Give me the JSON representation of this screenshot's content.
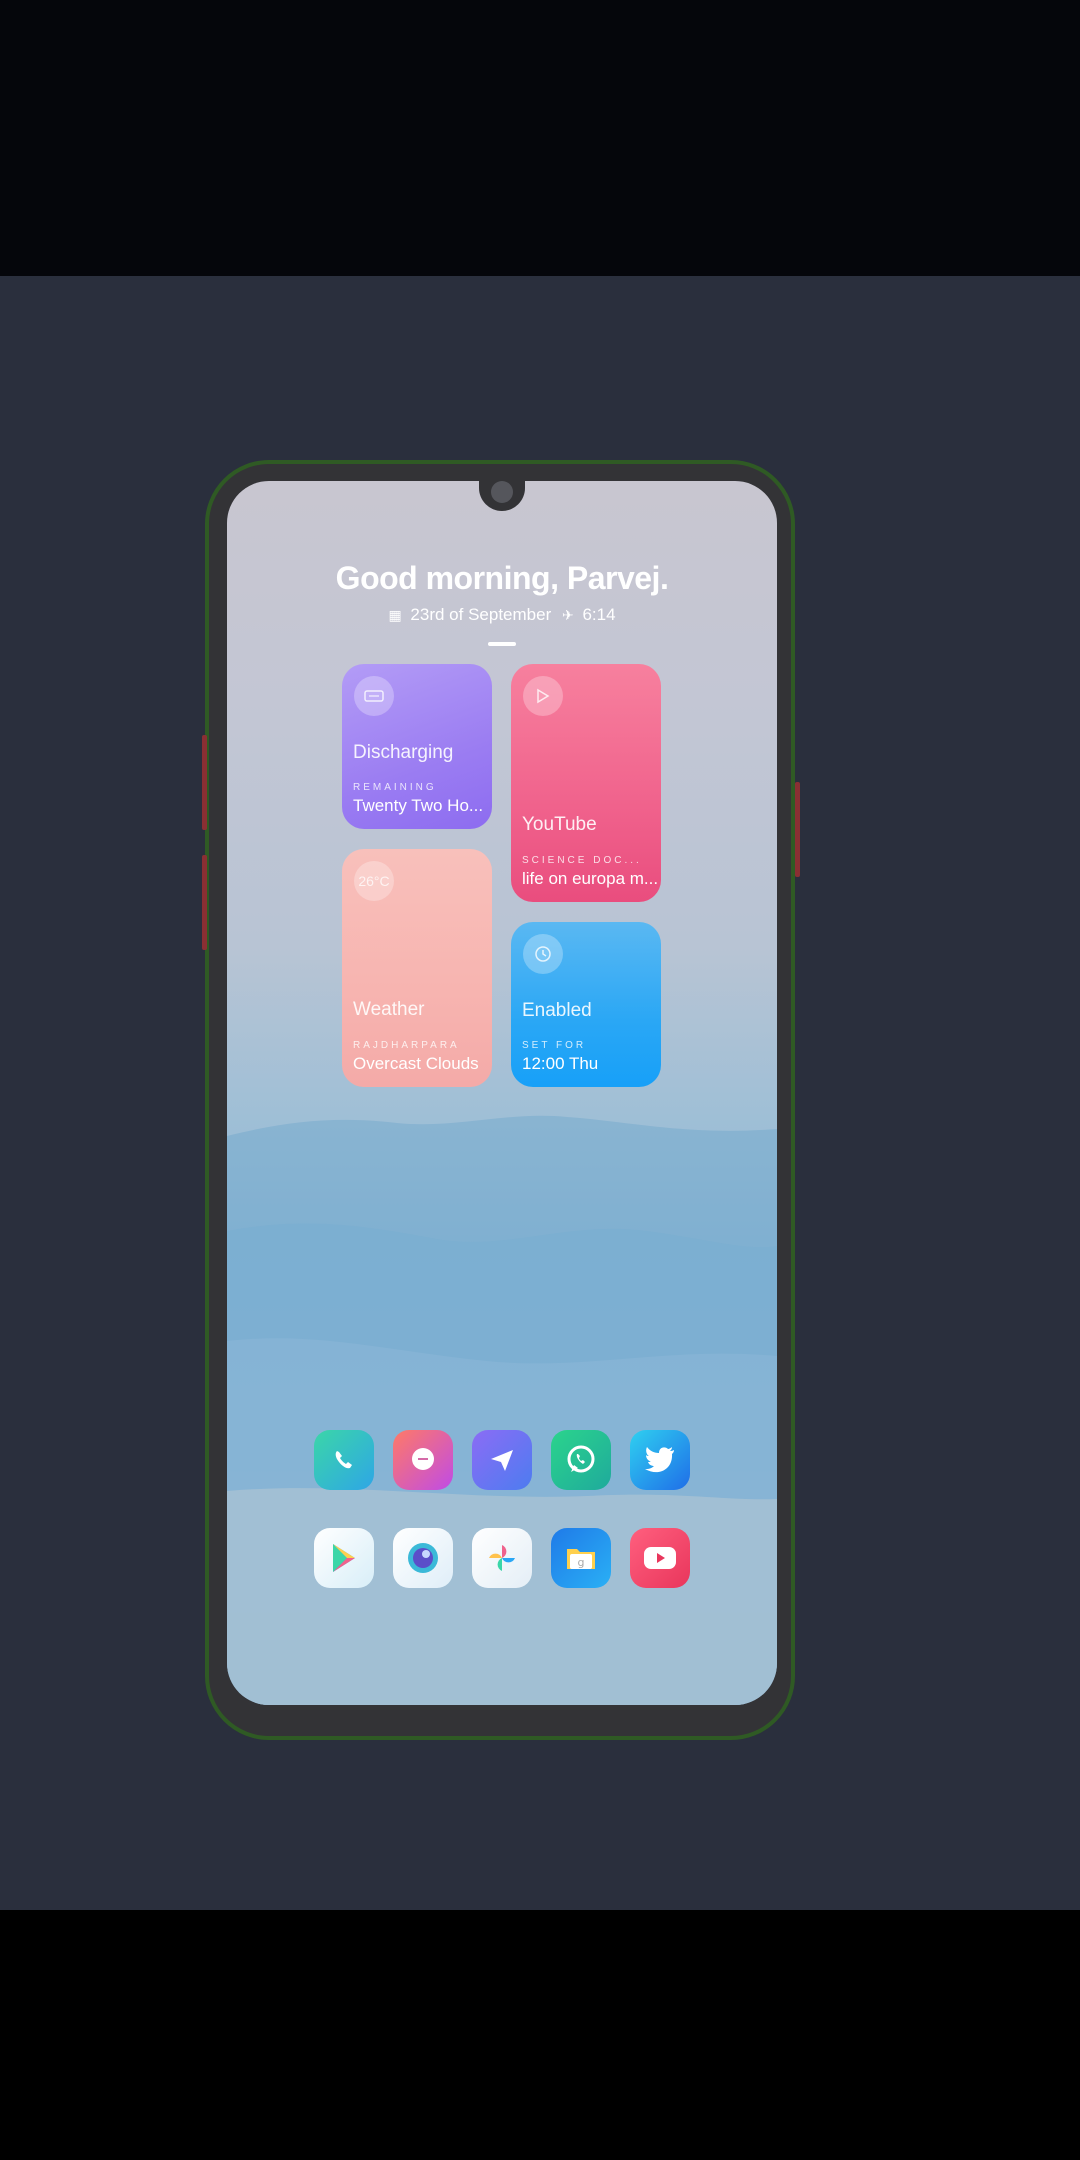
{
  "header": {
    "greeting": "Good morning, Parvej.",
    "date": "23rd of September",
    "time": "6:14"
  },
  "widgets": {
    "battery": {
      "title": "Discharging",
      "caption": "REMAINING",
      "value": "Twenty Two Ho...",
      "icon": "battery-icon"
    },
    "youtube": {
      "title": "YouTube",
      "caption": "SCIENCE DOC...",
      "value": "life on europa m...",
      "icon": "play-icon"
    },
    "weather": {
      "title": "Weather",
      "caption": "RAJDHARPARA",
      "value": "Overcast Clouds",
      "temp": "26°C"
    },
    "alarm": {
      "title": "Enabled",
      "caption": "SET FOR",
      "value": "12:00 Thu",
      "icon": "clock-icon"
    }
  },
  "dock_row1": [
    "phone",
    "messages",
    "send",
    "whatsapp",
    "twitter"
  ],
  "dock_row2": [
    "play-store",
    "camera",
    "photos",
    "files",
    "youtube"
  ],
  "colors": {
    "battery_card": "#9b7df2",
    "youtube_card": "#f0628c",
    "weather_card": "#f7b4b0",
    "alarm_card": "#2aa7f5",
    "frame_outline": "#2f5a24"
  }
}
